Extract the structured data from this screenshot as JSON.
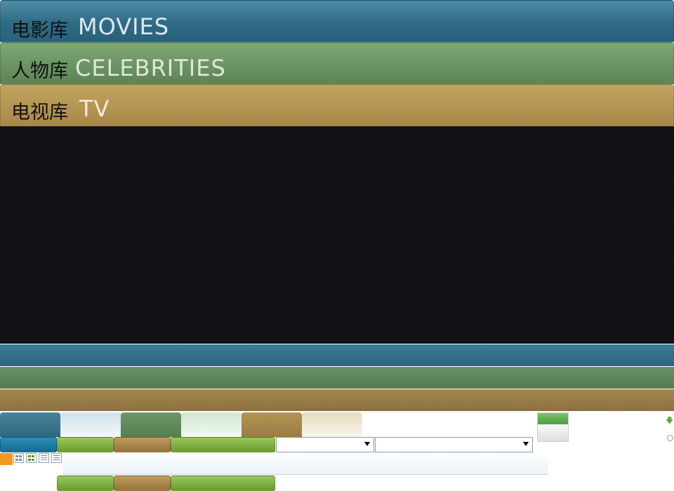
{
  "tabs": [
    {
      "cn": "电影库",
      "en": "MOVIES"
    },
    {
      "cn": "人物库",
      "en": "CELEBRITIES"
    },
    {
      "cn": "电视库",
      "en": "TV"
    }
  ],
  "colors": {
    "movies": "#2f6b86",
    "celebrities": "#5d8457",
    "tv": "#a8884a",
    "panel": "#0f1013",
    "accent_orange": "#f39a1e"
  },
  "selects": [
    {
      "value": ""
    },
    {
      "value": ""
    }
  ],
  "icons": [
    "grid-view-icon",
    "grid-view-active-icon",
    "list-view-icon",
    "list-view-active-icon",
    "arrow-down-icon",
    "radio-icon"
  ]
}
